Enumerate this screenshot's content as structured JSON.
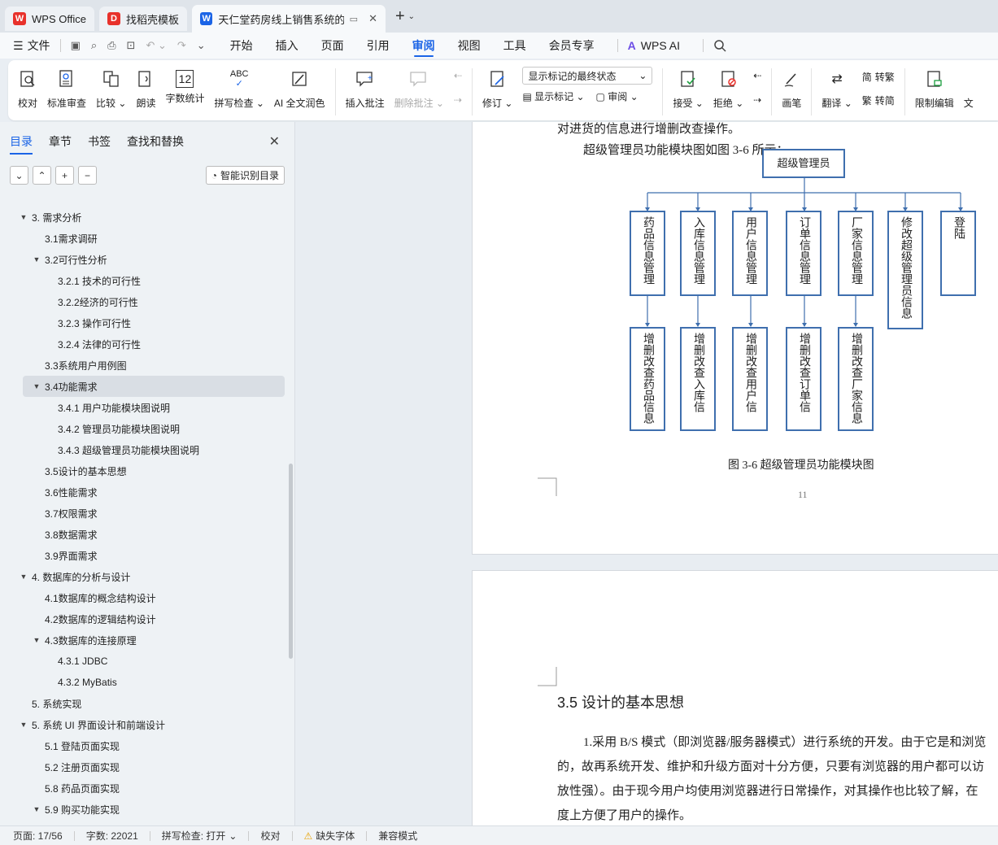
{
  "tabs": [
    {
      "label": "WPS Office",
      "logo": "W",
      "color": "#e8312b"
    },
    {
      "label": "找稻壳模板",
      "logo": "D",
      "color": "#e8312b"
    },
    {
      "label": "天仁堂药房线上销售系统的开",
      "logo": "W",
      "color": "#1b64e6"
    }
  ],
  "menu": {
    "file": "文件",
    "items": [
      "开始",
      "插入",
      "页面",
      "引用",
      "审阅",
      "视图",
      "工具",
      "会员专享"
    ],
    "active": "审阅",
    "wps_ai": "WPS AI"
  },
  "ribbon": {
    "proofread": "校对",
    "standard_review": "标准审查",
    "compare": "比较",
    "read_aloud": "朗读",
    "word_count": "字数统计",
    "word_count_icon_text": "12",
    "spell_check": "拼写检查",
    "spell_icon_text": "ABC",
    "ai_polish": "AI 全文润色",
    "insert_comment": "插入批注",
    "delete_comment": "删除批注",
    "revise": "修订",
    "display_state": "显示标记的最终状态",
    "show_marks": "显示标记",
    "review": "审阅",
    "accept": "接受",
    "reject": "拒绝",
    "pen": "画笔",
    "translate": "翻译",
    "to_traditional": "转繁",
    "to_simplified": "转简",
    "to_trad_icon": "简",
    "to_simp_icon": "繁",
    "restrict_edit": "限制编辑",
    "cut_text": "文"
  },
  "sidebar": {
    "tabs": [
      "目录",
      "章节",
      "书签",
      "查找和替换"
    ],
    "active_tab": "目录",
    "smart_toc": "智能识别目录",
    "toc": [
      {
        "label": "3.  需求分析",
        "level": 1,
        "arrow": "down"
      },
      {
        "label": "3.1需求调研",
        "level": 2,
        "arrow": ""
      },
      {
        "label": "3.2可行性分析",
        "level": 2,
        "arrow": "down"
      },
      {
        "label": "3.2.1  技术的可行性",
        "level": 3,
        "arrow": ""
      },
      {
        "label": "3.2.2经济的可行性",
        "level": 3,
        "arrow": ""
      },
      {
        "label": "3.2.3  操作可行性",
        "level": 3,
        "arrow": ""
      },
      {
        "label": "3.2.4  法律的可行性",
        "level": 3,
        "arrow": ""
      },
      {
        "label": "3.3系统用户用例图",
        "level": 2,
        "arrow": ""
      },
      {
        "label": "3.4功能需求",
        "level": 2,
        "arrow": "down",
        "selected": true
      },
      {
        "label": "3.4.1  用户功能模块图说明",
        "level": 3,
        "arrow": ""
      },
      {
        "label": "3.4.2  管理员功能模块图说明",
        "level": 3,
        "arrow": ""
      },
      {
        "label": "3.4.3  超级管理员功能模块图说明",
        "level": 3,
        "arrow": ""
      },
      {
        "label": "3.5设计的基本思想",
        "level": 2,
        "arrow": ""
      },
      {
        "label": "3.6性能需求",
        "level": 2,
        "arrow": ""
      },
      {
        "label": "3.7权限需求",
        "level": 2,
        "arrow": ""
      },
      {
        "label": "3.8数据需求",
        "level": 2,
        "arrow": ""
      },
      {
        "label": "3.9界面需求",
        "level": 2,
        "arrow": ""
      },
      {
        "label": "4.  数据库的分析与设计",
        "level": 1,
        "arrow": "down"
      },
      {
        "label": "4.1数据库的概念结构设计",
        "level": 2,
        "arrow": ""
      },
      {
        "label": "4.2数据库的逻辑结构设计",
        "level": 2,
        "arrow": ""
      },
      {
        "label": "4.3数据库的连接原理",
        "level": 2,
        "arrow": "down"
      },
      {
        "label": "4.3.1 JDBC",
        "level": 3,
        "arrow": ""
      },
      {
        "label": "4.3.2 MyBatis",
        "level": 3,
        "arrow": ""
      },
      {
        "label": "5.  系统实现",
        "level": 1,
        "arrow": ""
      },
      {
        "label": "5.  系统 UI 界面设计和前端设计",
        "level": 1,
        "arrow": "down"
      },
      {
        "label": "5.1  登陆页面实现",
        "level": 2,
        "arrow": ""
      },
      {
        "label": "5.2  注册页面实现",
        "level": 2,
        "arrow": ""
      },
      {
        "label": "5.8  药品页面实现",
        "level": 2,
        "arrow": ""
      },
      {
        "label": "5.9  购买功能实现",
        "level": 2,
        "arrow": "down"
      }
    ]
  },
  "document": {
    "page1_line1": "对进货的信息进行增删改查操作。",
    "page1_line2": "超级管理员功能模块图如图 3-6 所示：",
    "diagram": {
      "root": "超级管理员",
      "modules": [
        "药品信息管理",
        "入库信息管理",
        "用户信息管理",
        "订单信息管理",
        "厂家信息管理",
        "修改超级管理员信息",
        "登陆"
      ],
      "subs": [
        "增删改查药品信息",
        "增删改查入库信",
        "增删改查用户信",
        "增删改查订单信",
        "增删改查厂家信息"
      ]
    },
    "caption": "图 3-6 超级管理员功能模块图",
    "page_number": "11",
    "heading": "3.5  设计的基本思想",
    "para": [
      "1.采用 B/S 模式（即浏览器/服务器模式）进行系统的开发。由于它是和浏览",
      "的，故再系统开发、维护和升级方面对十分方便，只要有浏览器的用户都可以访",
      "放性强）。由于现今用户均使用浏览器进行日常操作，对其操作也比较了解，在",
      "度上方便了用户的操作。"
    ]
  },
  "status": {
    "page": "页面: 17/56",
    "words": "字数: 22021",
    "spell": "拼写检查: 打开",
    "proof": "校对",
    "missing_font": "缺失字体",
    "compat": "兼容模式"
  }
}
